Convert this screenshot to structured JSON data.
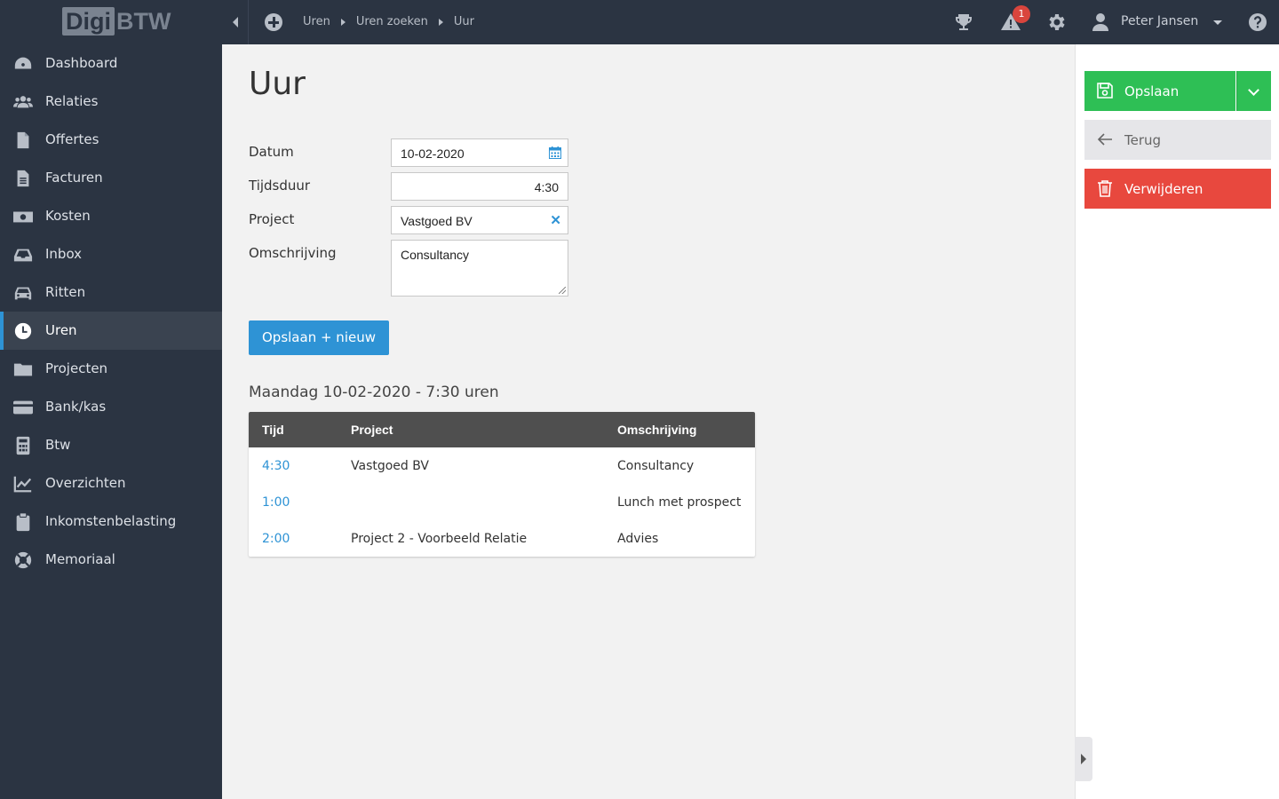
{
  "app": {
    "logo_left": "Digi",
    "logo_right": "BTW"
  },
  "topbar": {
    "breadcrumb": [
      "Uren",
      "Uren zoeken",
      "Uur"
    ],
    "notification_count": "1",
    "user_name": "Peter Jansen"
  },
  "sidebar": {
    "items": [
      {
        "label": "Dashboard",
        "icon": "dashboard-icon"
      },
      {
        "label": "Relaties",
        "icon": "users-icon"
      },
      {
        "label": "Offertes",
        "icon": "file-icon"
      },
      {
        "label": "Facturen",
        "icon": "invoice-icon"
      },
      {
        "label": "Kosten",
        "icon": "money-icon"
      },
      {
        "label": "Inbox",
        "icon": "inbox-icon"
      },
      {
        "label": "Ritten",
        "icon": "car-icon"
      },
      {
        "label": "Uren",
        "icon": "clock-icon",
        "active": true
      },
      {
        "label": "Projecten",
        "icon": "folder-icon"
      },
      {
        "label": "Bank/kas",
        "icon": "credit-card-icon"
      },
      {
        "label": "Btw",
        "icon": "calculator-icon"
      },
      {
        "label": "Overzichten",
        "icon": "line-chart-icon"
      },
      {
        "label": "Inkomstenbelasting",
        "icon": "clipboard-icon"
      },
      {
        "label": "Memoriaal",
        "icon": "lifebuoy-icon"
      }
    ]
  },
  "main": {
    "title": "Uur",
    "form": {
      "datum_label": "Datum",
      "datum_value": "10-02-2020",
      "tijdsduur_label": "Tijdsduur",
      "tijdsduur_value": "4:30",
      "project_label": "Project",
      "project_value": "Vastgoed BV",
      "omschrijving_label": "Omschrijving",
      "omschrijving_value": "Consultancy"
    },
    "save_new_label": "Opslaan + nieuw",
    "day_heading": "Maandag 10-02-2020 - 7:30 uren",
    "table": {
      "headers": [
        "Tijd",
        "Project",
        "Omschrijving"
      ],
      "rows": [
        {
          "tijd": "4:30",
          "project": "Vastgoed BV",
          "omschrijving": "Consultancy"
        },
        {
          "tijd": "1:00",
          "project": "",
          "omschrijving": "Lunch met prospect"
        },
        {
          "tijd": "2:00",
          "project": "Project 2 - Voorbeeld Relatie",
          "omschrijving": "Advies"
        }
      ]
    }
  },
  "actions": {
    "save_label": "Opslaan",
    "back_label": "Terug",
    "delete_label": "Verwijderen"
  },
  "colors": {
    "sidebar_bg": "#2b3442",
    "accent_blue": "#2e93d5",
    "save_green": "#2ebf55",
    "delete_red": "#e8483e",
    "table_header": "#4f4f4f"
  }
}
